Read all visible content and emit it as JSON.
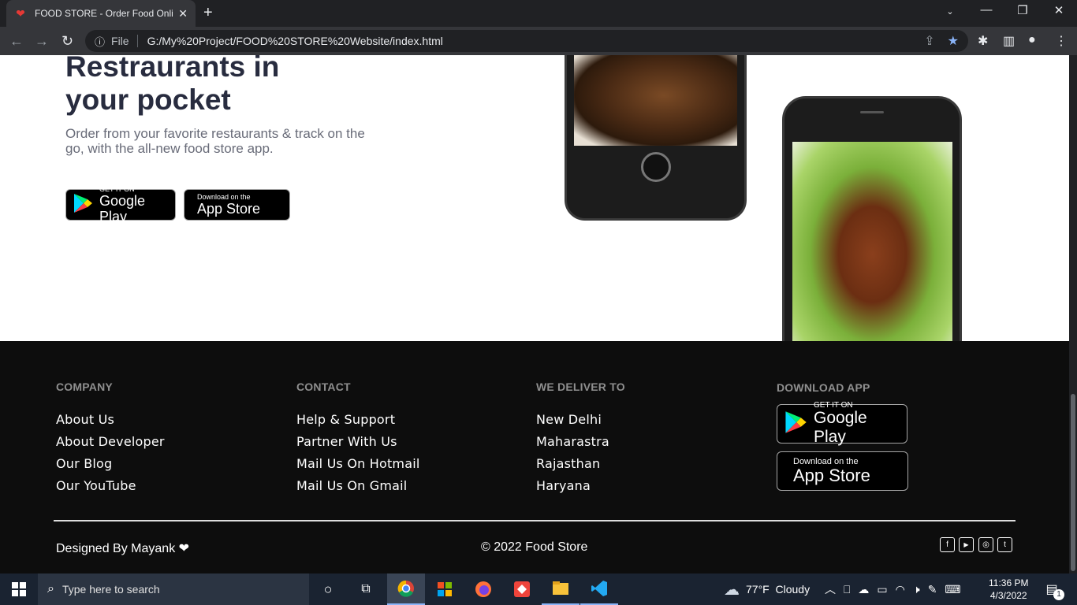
{
  "browser": {
    "tab_title": "FOOD STORE - Order Food Onlin",
    "tab_close": "✕",
    "new_tab": "+",
    "info_icon": "ⓘ",
    "file_label": "File",
    "url": "G:/My%20Project/FOOD%20STORE%20Website/index.html"
  },
  "hero": {
    "title_line1": "Restraurants in",
    "title_line2": "your pocket",
    "subtitle": "Order from your favorite restaurants & track on the go, with the all-new food store app.",
    "google_small": "GET IT ON",
    "google_large": "Google Play",
    "apple_small": "Download on the",
    "apple_large": "App Store"
  },
  "footer": {
    "columns": [
      {
        "heading": "COMPANY",
        "links": [
          "About Us",
          "About Developer",
          "Our Blog",
          "Our YouTube"
        ]
      },
      {
        "heading": "CONTACT",
        "links": [
          "Help & Support",
          "Partner With Us",
          "Mail Us On Hotmail",
          "Mail Us On Gmail"
        ]
      },
      {
        "heading": "WE DELIVER TO",
        "links": [
          "New Delhi",
          "Maharastra",
          "Rajasthan",
          "Haryana"
        ]
      },
      {
        "heading": "DOWNLOAD APP"
      }
    ],
    "designed_by": "Designed By Mayank",
    "heart": "❤",
    "copyright": "© 2022 Food Store",
    "social": [
      {
        "icon": "facebook-icon",
        "glyph": "f"
      },
      {
        "icon": "youtube-icon",
        "glyph": "▶"
      },
      {
        "icon": "instagram-icon",
        "glyph": "◎"
      },
      {
        "icon": "twitter-icon",
        "glyph": "t"
      }
    ]
  },
  "taskbar": {
    "search_placeholder": "Type here to search",
    "weather": "77°F  Cloudy",
    "time": "11:36 PM",
    "date": "4/3/2022",
    "notification_count": "1"
  },
  "colors": {
    "accent": "#8ab4f8",
    "heading": "#282c3f",
    "footer_bg": "#0d0d0d"
  }
}
